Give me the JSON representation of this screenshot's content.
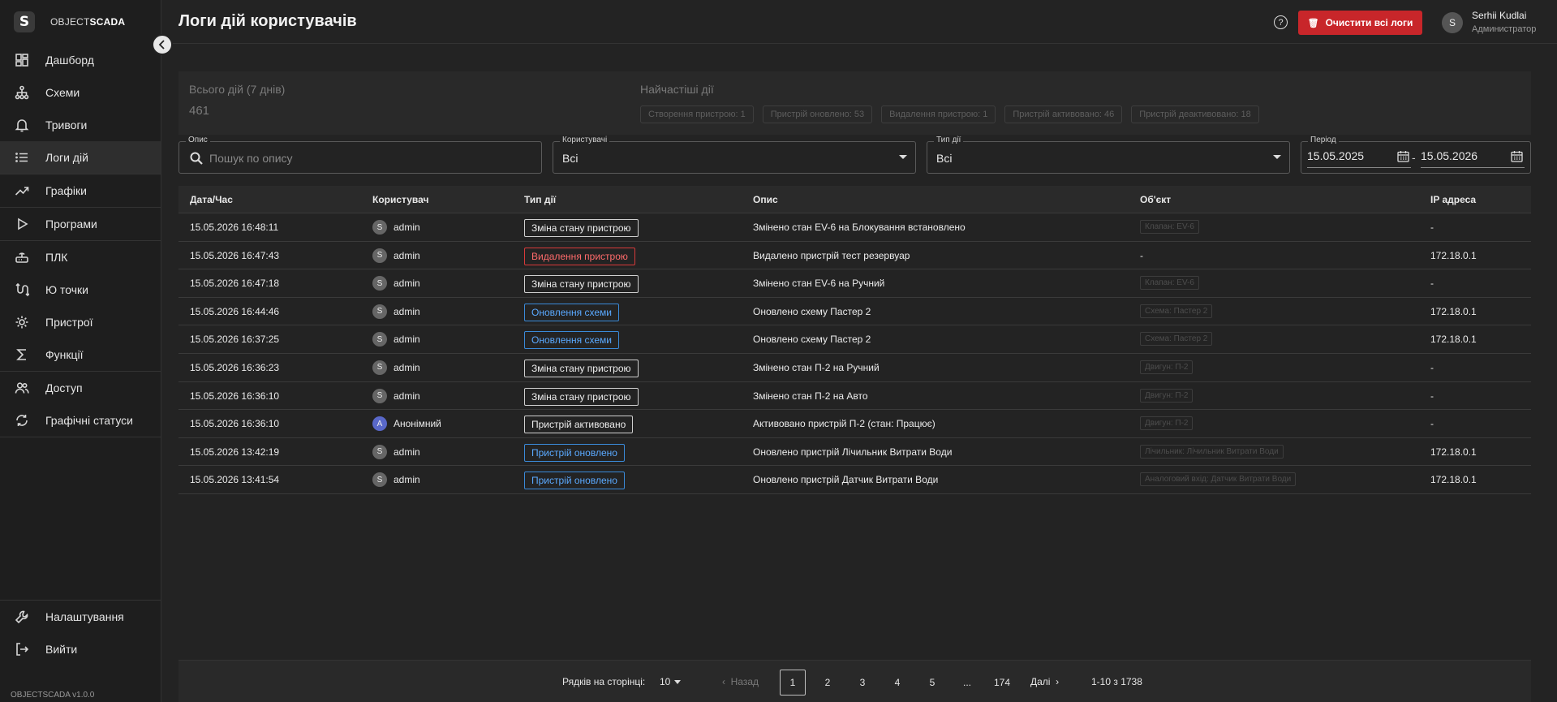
{
  "brand": {
    "logo": "S",
    "name_light": "OBJECT",
    "name_bold": "SCADA"
  },
  "sidebar": {
    "groups": [
      [
        {
          "label": "Дашборд",
          "icon": "dashboard-icon"
        },
        {
          "label": "Схеми",
          "icon": "schemes-icon"
        },
        {
          "label": "Тривоги",
          "icon": "bell-icon"
        },
        {
          "label": "Логи дій",
          "icon": "list-icon",
          "active": true
        }
      ],
      [
        {
          "label": "Графіки",
          "icon": "trend-icon"
        }
      ],
      [
        {
          "label": "Програми",
          "icon": "play-icon"
        }
      ],
      [
        {
          "label": "ПЛК",
          "icon": "router-icon"
        },
        {
          "label": "Ю точки",
          "icon": "io-icon"
        },
        {
          "label": "Пристрої",
          "icon": "device-gear-icon"
        },
        {
          "label": "Функції",
          "icon": "sigma-icon"
        }
      ],
      [
        {
          "label": "Доступ",
          "icon": "users-icon"
        },
        {
          "label": "Графічні статуси",
          "icon": "refresh-icon"
        }
      ]
    ],
    "bottom": [
      {
        "label": "Налаштування",
        "icon": "wrench-icon"
      },
      {
        "label": "Вийти",
        "icon": "logout-icon"
      }
    ],
    "version": "OBJECTSCADA v1.0.0"
  },
  "header": {
    "title": "Логи дій користувачів",
    "clear_button": "Очистити всі логи",
    "user": {
      "initial": "S",
      "name": "Serhii Kudlai",
      "role": "Администратор"
    }
  },
  "stats": {
    "total_label": "Всього дій (7 днів)",
    "total_value": "461",
    "top_label": "Найчастіші дії",
    "chips": [
      "Створення пристрою: 1",
      "Пристрій оновлено: 53",
      "Видалення пристрою: 1",
      "Пристрій активовано: 46",
      "Пристрій деактивовано: 18"
    ]
  },
  "filters": {
    "description": {
      "label": "Опис",
      "placeholder": "Пошук по опису"
    },
    "users": {
      "label": "Користувачі",
      "value": "Всі"
    },
    "action_type": {
      "label": "Тип дії",
      "value": "Всі"
    },
    "period": {
      "label": "Період",
      "from": "15.05.2025",
      "dash": "-",
      "to": "15.05.2026"
    }
  },
  "table": {
    "columns": [
      "Дата/Час",
      "Користувач",
      "Тип дії",
      "Опис",
      "Об'єкт",
      "IP адреса"
    ],
    "rows": [
      {
        "datetime": "15.05.2026 16:48:11",
        "user": "admin",
        "initial": "S",
        "anon": false,
        "action": "Зміна стану пристрою",
        "kind": "plain",
        "description": "Змінено стан EV-6 на Блокування встановлено",
        "object": "Клапан: EV-6",
        "ip": "-"
      },
      {
        "datetime": "15.05.2026 16:47:43",
        "user": "admin",
        "initial": "S",
        "anon": false,
        "action": "Видалення пристрою",
        "kind": "red",
        "description": "Видалено пристрій тест резервуар",
        "object": "",
        "object_text": "-",
        "ip": "172.18.0.1"
      },
      {
        "datetime": "15.05.2026 16:47:18",
        "user": "admin",
        "initial": "S",
        "anon": false,
        "action": "Зміна стану пристрою",
        "kind": "plain",
        "description": "Змінено стан EV-6 на Ручний",
        "object": "Клапан: EV-6",
        "ip": "-"
      },
      {
        "datetime": "15.05.2026 16:44:46",
        "user": "admin",
        "initial": "S",
        "anon": false,
        "action": "Оновлення схеми",
        "kind": "blue",
        "description": "Оновлено схему Пастер 2",
        "object": "Схема: Пастер 2",
        "ip": "172.18.0.1"
      },
      {
        "datetime": "15.05.2026 16:37:25",
        "user": "admin",
        "initial": "S",
        "anon": false,
        "action": "Оновлення схеми",
        "kind": "blue",
        "description": "Оновлено схему Пастер 2",
        "object": "Схема: Пастер 2",
        "ip": "172.18.0.1"
      },
      {
        "datetime": "15.05.2026 16:36:23",
        "user": "admin",
        "initial": "S",
        "anon": false,
        "action": "Зміна стану пристрою",
        "kind": "plain",
        "description": "Змінено стан П-2 на Ручний",
        "object": "Двигун: П-2",
        "ip": "-"
      },
      {
        "datetime": "15.05.2026 16:36:10",
        "user": "admin",
        "initial": "S",
        "anon": false,
        "action": "Зміна стану пристрою",
        "kind": "plain",
        "description": "Змінено стан П-2 на Авто",
        "object": "Двигун: П-2",
        "ip": "-"
      },
      {
        "datetime": "15.05.2026 16:36:10",
        "user": "Анонімний",
        "initial": "A",
        "anon": true,
        "action": "Пристрій активовано",
        "kind": "plain",
        "description": "Активовано пристрій П-2 (стан: Працює)",
        "object": "Двигун: П-2",
        "ip": "-"
      },
      {
        "datetime": "15.05.2026 13:42:19",
        "user": "admin",
        "initial": "S",
        "anon": false,
        "action": "Пристрій оновлено",
        "kind": "blue",
        "description": "Оновлено пристрій Лічильник Витрати Води",
        "object": "Лічильник: Лічильник Витрати Води",
        "ip": "172.18.0.1"
      },
      {
        "datetime": "15.05.2026 13:41:54",
        "user": "admin",
        "initial": "S",
        "anon": false,
        "action": "Пристрій оновлено",
        "kind": "blue",
        "description": "Оновлено пристрій Датчик Витрати Води",
        "object": "Аналоговий вхід: Датчик Витрати Води",
        "ip": "172.18.0.1"
      }
    ]
  },
  "pagination": {
    "rows_label": "Рядків на сторінці:",
    "rows_value": "10",
    "prev": "Назад",
    "pages": [
      "1",
      "2",
      "3",
      "4",
      "5",
      "...",
      "174"
    ],
    "current": "1",
    "next": "Далі",
    "range": "1-10 з 1738"
  },
  "colors": {
    "accent_red": "#c8262a",
    "badge_blue": "#3a8ad8",
    "badge_red": "#d83a3a",
    "anon_avatar": "#5968c9"
  }
}
